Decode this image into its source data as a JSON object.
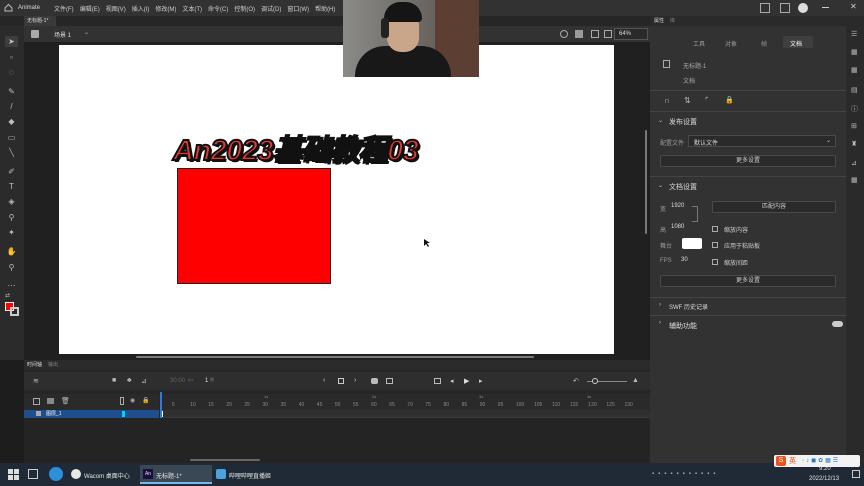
{
  "menubar": {
    "app_name": "Animate",
    "items": [
      "文件(F)",
      "编辑(E)",
      "视图(V)",
      "插入(I)",
      "修改(M)",
      "文本(T)",
      "命令(C)",
      "控制(O)",
      "调试(D)",
      "窗口(W)",
      "帮助(H)"
    ]
  },
  "document_tab": {
    "title": "无标题-1*"
  },
  "edit_bar": {
    "scene": "场景 1",
    "zoom": "64%"
  },
  "stage": {
    "headline": "An2023基础教程03"
  },
  "timeline": {
    "tabs": [
      "时间轴",
      "输出"
    ],
    "fps": "30.00",
    "fps_unit": "fps",
    "frame": "1",
    "frame_unit": "帧",
    "second_markers": [
      "1s",
      "2s",
      "3s",
      "4s"
    ],
    "frame_numbers": [
      "5",
      "10",
      "15",
      "20",
      "25",
      "30",
      "35",
      "40",
      "45",
      "50",
      "55",
      "60",
      "65",
      "70",
      "75",
      "80",
      "85",
      "90",
      "95",
      "100",
      "105",
      "110",
      "115",
      "120",
      "125",
      "130"
    ],
    "layer_name": "图层_1"
  },
  "properties": {
    "panel_tabs": [
      "属性",
      "库"
    ],
    "tabs": [
      "工具",
      "对象",
      "帧",
      "文档"
    ],
    "active_tab": "文档",
    "doc_name": "无标题-1",
    "doc_type": "文档",
    "publish_settings": {
      "title": "发布设置",
      "profile_label": "配置文件",
      "profile_value": "默认文件",
      "more_button": "更多设置"
    },
    "document_settings": {
      "title": "文档设置",
      "width_label": "宽",
      "width_value": "1920",
      "height_label": "高",
      "height_value": "1080",
      "stage_label": "舞台",
      "fps_label": "FPS",
      "fps_value": "30",
      "match_button": "匹配内容",
      "scale_content": "缩放内容",
      "apply_pasteboard": "应用于粘贴板",
      "scale_spacing": "缩放间距",
      "more_button": "更多设置"
    },
    "swf_history": "SWF 历史记录",
    "accessibility": "辅助功能"
  },
  "taskbar": {
    "apps": [
      "Wacom 桌面中心",
      "无标题-1*",
      "哔哩哔哩直播姬"
    ],
    "time": "9:20",
    "date": "2022/12/13",
    "ime": "英"
  },
  "colors": {
    "stroke": "#000000",
    "fill": "#ff0000",
    "rect_fill": "#fe0000",
    "headline_fill": "#e53935"
  }
}
